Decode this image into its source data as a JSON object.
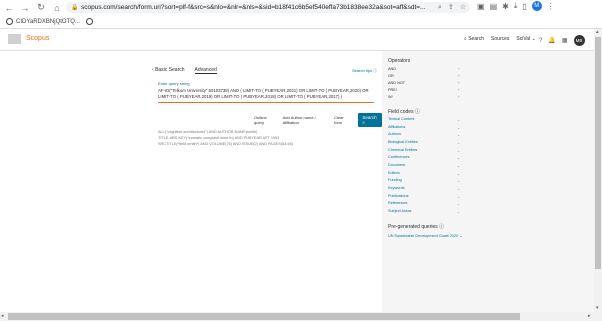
{
  "browser": {
    "url": "scopus.com/search/form.uri?sort=plf-f&src=s&nlo=&nlr=&nls=&sid=b18f41c6b5ef540effa73b1838ee32a&sot=aff&sdt=...",
    "bookmark_label": "CIDYaRDXBNjQtOTQ...",
    "avatar_letter": "M"
  },
  "header": {
    "logo": "Scopus",
    "links": [
      "Search",
      "Sources",
      "SciVal"
    ],
    "user_initials": "MB"
  },
  "tabs": {
    "basic": "Basic Search",
    "advanced": "Advanced"
  },
  "search_tips": "Search tips",
  "query": {
    "label": "Enter query string",
    "text": "AF-ID(\"Telkom University\" 60103738) AND ( LIMIT-TO ( PUBYEAR,2021) OR LIMIT-TO ( PUBYEAR,2020) OR LIMIT-TO ( PUBYEAR,2019) OR LIMIT-TO ( PUBYEAR,2018) OR LIMIT-TO ( PUBYEAR,2017) )"
  },
  "actions": {
    "outline": "Outline query",
    "author": "Add Author name / Affiliation",
    "clear": "Clear form",
    "search": "Search"
  },
  "examples": [
    "ALL(\"cognitive architectures\") AND AUTHOR-NAME(smith)",
    "TITLE-ABS-KEY(*somatic complaint wom?n) AND PUBYEAR AFT 1993",
    "SRCTITLE(*field ornith*) AND VOLUME(75) AND ISSUE(2) AND PAGES(53-66)"
  ],
  "operators": {
    "title": "Operators",
    "items": [
      "AND",
      "OR",
      "AND NOT",
      "PRE/",
      "W/"
    ]
  },
  "field_codes": {
    "title": "Field codes",
    "items": [
      "Textual Content",
      "Affiliations",
      "Authors",
      "Biological Entities",
      "Chemical Entities",
      "Conferences",
      "Document",
      "Editors",
      "Funding",
      "Keywords",
      "Publications",
      "References",
      "Subject Areas"
    ]
  },
  "pregen": {
    "title": "Pre-generated queries",
    "link": "UN Sustainable Development Goals 2020"
  }
}
